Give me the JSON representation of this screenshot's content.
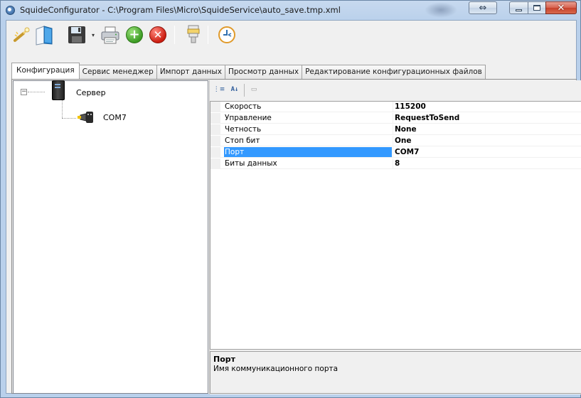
{
  "window": {
    "title": "SquideConfigurator - C:\\Program Files\\Micro\\SquideService\\auto_save.tmp.xml",
    "close_glyph": "✕",
    "resize_glyph": "⇔"
  },
  "toolbar": {
    "items": [
      {
        "name": "wand-icon"
      },
      {
        "name": "book-icon"
      },
      {
        "name": "save-icon"
      },
      {
        "name": "print-icon"
      },
      {
        "name": "add-icon",
        "glyph": "+"
      },
      {
        "name": "delete-icon",
        "glyph": "✕"
      },
      {
        "name": "plug-icon"
      },
      {
        "name": "clock-icon"
      }
    ]
  },
  "tabs": [
    {
      "label": "Конфигурация",
      "active": true
    },
    {
      "label": "Сервис менеджер"
    },
    {
      "label": "Импорт данных"
    },
    {
      "label": "Просмотр данных"
    },
    {
      "label": "Редактирование конфигурационных файлов"
    }
  ],
  "tree": {
    "expander": "−",
    "root": {
      "label": "Сервер",
      "icon": "server-icon"
    },
    "child": {
      "label": "COM7",
      "icon": "serial-port-icon"
    }
  },
  "property_grid": {
    "toolbar": {
      "categorized_icon": "⋮≡",
      "alphabetical_icon": "A↓",
      "pages_icon": "▭"
    },
    "rows": [
      {
        "name": "Скорость",
        "value": "115200"
      },
      {
        "name": "Управление",
        "value": "RequestToSend"
      },
      {
        "name": "Четность",
        "value": "None"
      },
      {
        "name": "Стоп бит",
        "value": "One"
      },
      {
        "name": "Порт",
        "value": "COM7",
        "selected": true
      },
      {
        "name": "Биты данных",
        "value": "8"
      }
    ],
    "help": {
      "title": "Порт",
      "description": "Имя коммуникационного порта"
    }
  },
  "colors": {
    "selection": "#3399ff",
    "title_bar": "#b9d0eb",
    "close_button": "#c7412c"
  }
}
